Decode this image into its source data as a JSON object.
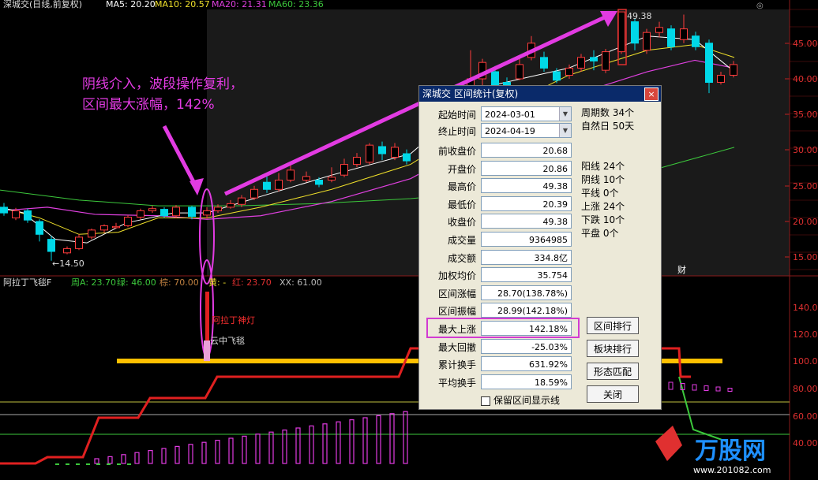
{
  "header": {
    "title": "深城交(日线,前复权)",
    "ma_items": [
      {
        "label": "MA5: 20.20",
        "color": "#ffffff"
      },
      {
        "label": "MA10: 20.57",
        "color": "#f0e02a"
      },
      {
        "label": "MA20: 21.31",
        "color": "#e040e0"
      },
      {
        "label": "MA60: 23.36",
        "color": "#3cc83c"
      }
    ]
  },
  "annotation": {
    "line1": "阴线介入，波段操作复利，",
    "line2": "区间最大涨幅，142%"
  },
  "price_axis": [
    "45.00",
    "40.00",
    "35.00",
    "30.00",
    "25.00",
    "20.00",
    "15.00"
  ],
  "indicator_axis": [
    "140.00",
    "120.00",
    "100.00",
    "80.00",
    "60.00",
    "40.00"
  ],
  "labels": {
    "high_mark": "49.38",
    "low_mark": "←14.50",
    "cai": "财",
    "signal1": "阿拉丁神灯",
    "signal2": "云中飞毯"
  },
  "indicator_header": [
    {
      "text": "阿拉丁飞毯F",
      "color": "#dddddd"
    },
    {
      "text": "周A: 23.70",
      "color": "#3cc83c"
    },
    {
      "text": "绿: 46.00",
      "color": "#3cc83c"
    },
    {
      "text": "棕: 70.00",
      "color": "#c08040"
    },
    {
      "text": "黄: -",
      "color": "#f0e02a"
    },
    {
      "text": "红: 23.70",
      "color": "#e03030"
    },
    {
      "text": "XX: 61.00",
      "color": "#bbbbbb"
    }
  ],
  "dialog": {
    "title": "深城交 区间统计(复权)",
    "close": "×",
    "start_label": "起始时间",
    "start_value": "2024-03-01",
    "end_label": "终止时间",
    "end_value": "2024-04-19",
    "rows": [
      {
        "label": "前收盘价",
        "value": "20.68"
      },
      {
        "label": "开盘价",
        "value": "20.86"
      },
      {
        "label": "最高价",
        "value": "49.38"
      },
      {
        "label": "最低价",
        "value": "20.39"
      },
      {
        "label": "收盘价",
        "value": "49.38"
      },
      {
        "label": "成交量",
        "value": "9364985"
      },
      {
        "label": "成交额",
        "value": "334.8亿"
      },
      {
        "label": "加权均价",
        "value": "35.754"
      },
      {
        "label": "区间涨幅",
        "value": "28.70(138.78%)"
      },
      {
        "label": "区间振幅",
        "value": "28.99(142.18%)"
      },
      {
        "label": "最大上涨",
        "value": "142.18%"
      },
      {
        "label": "最大回撤",
        "value": "-25.03%"
      },
      {
        "label": "累计换手",
        "value": "631.92%"
      },
      {
        "label": "平均换手",
        "value": "18.59%"
      }
    ],
    "side_stats": [
      "周期数 34个",
      "自然日 50天",
      "",
      "",
      "阳线 24个",
      "阴线 10个",
      "平线 0个",
      "上涨 24个",
      "下跌 10个",
      "平盘 0个"
    ],
    "buttons": [
      "区间排行",
      "板块排行",
      "形态匹配",
      "关闭"
    ],
    "checkbox": "保留区间显示线"
  },
  "watermark": {
    "brand": "万股网",
    "url": "www.201082.com"
  },
  "colors": {
    "up": "#ff3c3c",
    "down": "#00d8e8",
    "grid": "#8a1a1a",
    "magenta": "#e23be2",
    "orange": "#ffc000"
  }
}
